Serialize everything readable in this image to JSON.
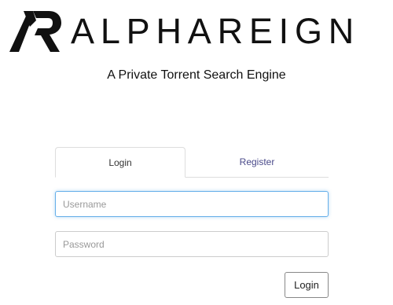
{
  "brand": {
    "name": "ALPHAREIGN",
    "tagline": "A Private Torrent Search Engine",
    "logo_icon": "ar-monogram-icon"
  },
  "tabs": [
    {
      "label": "Login",
      "active": true
    },
    {
      "label": "Register",
      "active": false
    }
  ],
  "form": {
    "username": {
      "value": "",
      "placeholder": "Username"
    },
    "password": {
      "value": "",
      "placeholder": "Password"
    },
    "submit_label": "Login"
  },
  "colors": {
    "focus_border": "#66afe9",
    "register_tab_text": "#4a4a8a"
  }
}
